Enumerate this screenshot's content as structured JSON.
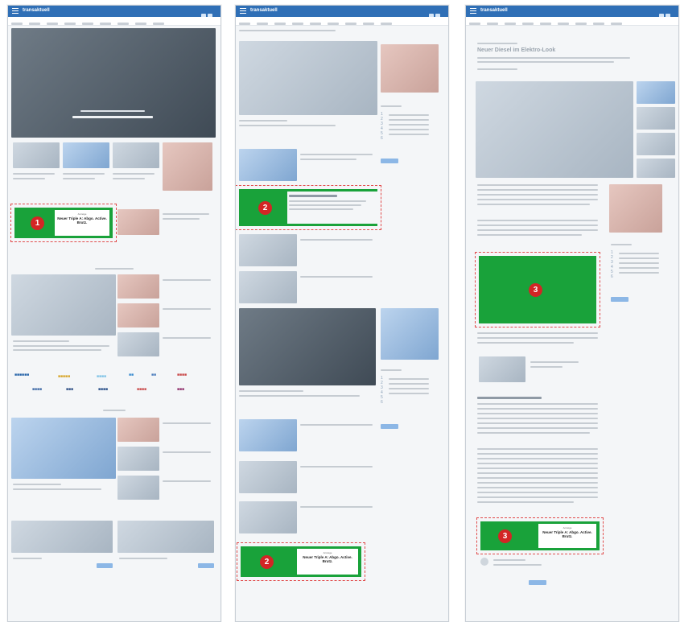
{
  "panel1": {
    "brand": "transaktuell",
    "ad_badge": "1",
    "ad_small_label": "Anzeige",
    "ad_text": "Neuer Triple A: Abgo. Active. Brutz."
  },
  "panel2": {
    "brand": "transaktuell",
    "ad_badge_top": "2",
    "ad_badge_bottom": "2",
    "ad_small_label": "Anzeige",
    "ad_text": "Neuer Triple A: Abgo. Active. Brutz."
  },
  "panel3": {
    "brand": "transaktuell",
    "article_title": "Neuer Diesel im Elektro-Look",
    "ad_badge_mid": "3",
    "ad_badge_bottom": "3",
    "ad_small_label": "Anzeige",
    "ad_text": "Neuer Triple A: Abgo. Active. Brutz."
  },
  "colors": {
    "ad_green": "#19a23a",
    "badge_red": "#d32525",
    "topbar_blue": "#2f6fb6"
  }
}
